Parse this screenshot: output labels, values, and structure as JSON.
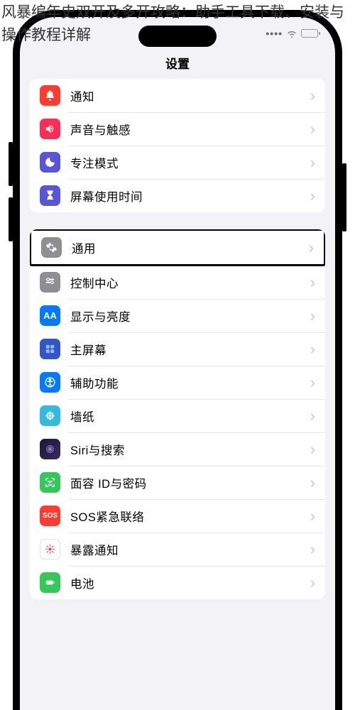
{
  "overlay_title": "风暴编年史双开及多开攻略：助手工具下载、安装与操作教程详解",
  "header": {
    "title": "设置"
  },
  "group1": [
    {
      "name": "notifications",
      "label": "通知",
      "icon": "bell-icon"
    },
    {
      "name": "sound",
      "label": "声音与触感",
      "icon": "speaker-icon"
    },
    {
      "name": "focus",
      "label": "专注模式",
      "icon": "moon-icon"
    },
    {
      "name": "screentime",
      "label": "屏幕使用时间",
      "icon": "hourglass-icon"
    }
  ],
  "group2": [
    {
      "name": "general",
      "label": "通用",
      "icon": "gear-icon",
      "highlight": true
    },
    {
      "name": "control-center",
      "label": "控制中心",
      "icon": "sliders-icon"
    },
    {
      "name": "display",
      "label": "显示与亮度",
      "icon": "display-icon",
      "badge": "AA"
    },
    {
      "name": "home-screen",
      "label": "主屏幕",
      "icon": "grid-icon"
    },
    {
      "name": "accessibility",
      "label": "辅助功能",
      "icon": "accessibility-icon"
    },
    {
      "name": "wallpaper",
      "label": "墙纸",
      "icon": "flower-icon"
    },
    {
      "name": "siri",
      "label": "Siri与搜索",
      "icon": "siri-icon"
    },
    {
      "name": "faceid",
      "label": "面容 ID与密码",
      "icon": "face-icon"
    },
    {
      "name": "sos",
      "label": "SOS紧急联络",
      "icon": "sos-icon",
      "badge": "SOS"
    },
    {
      "name": "exposure",
      "label": "暴露通知",
      "icon": "exposure-icon"
    },
    {
      "name": "battery",
      "label": "电池",
      "icon": "battery-icon"
    }
  ]
}
